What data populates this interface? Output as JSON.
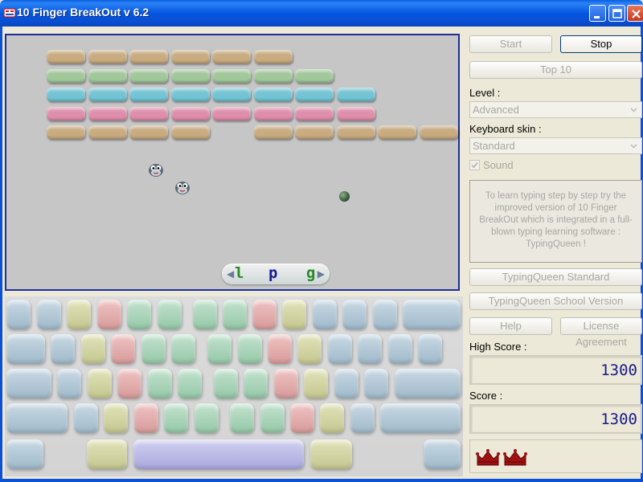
{
  "window": {
    "title": "10 Finger BreakOut v 6.2"
  },
  "colors": {
    "brick_tan": "#c9a97a",
    "brick_green": "#9dc896",
    "brick_cyan": "#6cc4d6",
    "brick_pink": "#e08aa8",
    "game_background": "#c6c6c6",
    "ball": "#3d5f3d",
    "paddle_letter_l": "#2a8a2a",
    "paddle_letter_p": "#1a1a9a",
    "paddle_letter_g": "#2a8a2a",
    "score_text": "#1a1a8a",
    "crown": "#a01010"
  },
  "game": {
    "paddle_letters": [
      "l",
      "p",
      "g"
    ],
    "brick_rows": [
      {
        "color": "tan",
        "count": 6
      },
      {
        "color": "green",
        "count": 7
      },
      {
        "color": "cyan",
        "count": 8
      },
      {
        "color": "pink",
        "count": 8
      },
      {
        "color": "tan",
        "count": 9,
        "gap_after": 4
      }
    ]
  },
  "controls": {
    "start_label": "Start",
    "stop_label": "Stop",
    "top10_label": "Top 10",
    "level_label": "Level :",
    "level_value": "Advanced",
    "keyboard_skin_label": "Keyboard skin :",
    "keyboard_skin_value": "Standard",
    "sound_label": "Sound",
    "sound_checked": true,
    "info_text": "To learn typing step by step try the improved version of 10 Finger BreakOut which is integrated in a full-blown typing learning software : TypingQueen !",
    "typingqueen_standard_label": "TypingQueen Standard",
    "typingqueen_school_label": "TypingQueen School Version",
    "help_label": "Help",
    "license_label": "License Agreement"
  },
  "scores": {
    "high_score_label": "High Score :",
    "high_score_value": "1300",
    "score_label": "Score :",
    "score_value": "1300",
    "crowns": 2
  }
}
